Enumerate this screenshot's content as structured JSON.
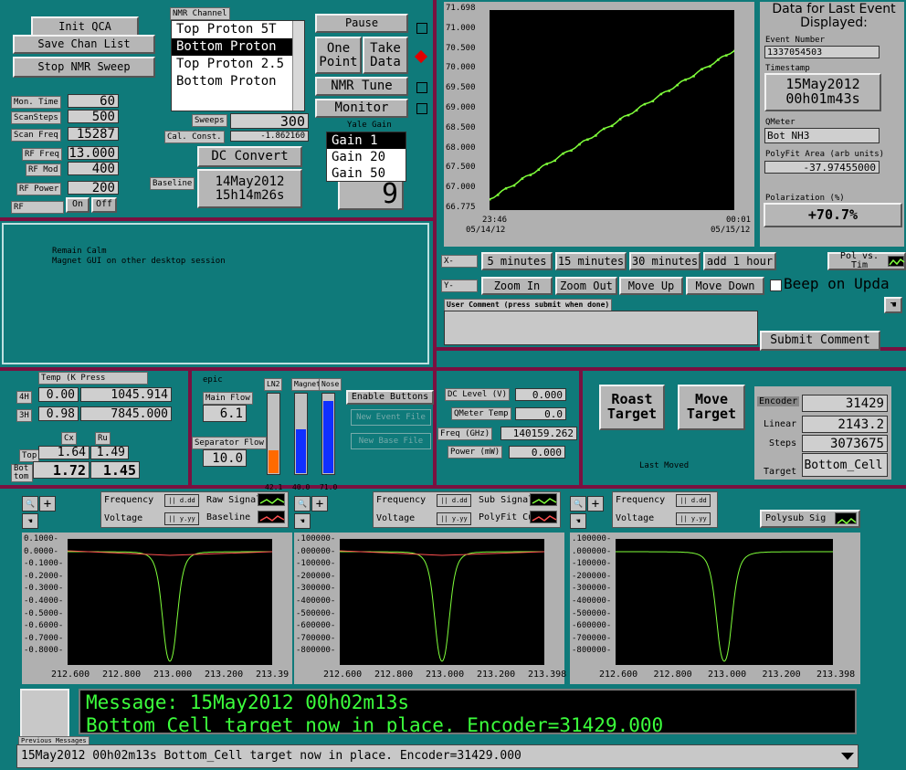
{
  "colors": {
    "bg": "#0f7a7a",
    "divider": "#7a1040",
    "trace_green": "#7fff3a",
    "trace_red": "#ff5050",
    "msg_green": "#3cff3c"
  },
  "left": {
    "init_qca": "Init QCA",
    "save_chan": "Save Chan List",
    "stop_nmr": "Stop NMR Sweep",
    "params": [
      {
        "label": "Mon. Time",
        "value": "60"
      },
      {
        "label": "ScanSteps",
        "value": "500"
      },
      {
        "label": "Scan Freq",
        "value": "15287"
      },
      {
        "label": "RF Freq",
        "value": "13.000"
      },
      {
        "label": "RF Mod",
        "value": "400"
      },
      {
        "label": "RF Power",
        "value": "200"
      }
    ],
    "rf_label": "RF",
    "on": "On",
    "off": "Off"
  },
  "nmr": {
    "channel_label": "NMR Channel",
    "channels": [
      "Top Proton 5T",
      "Bottom Proton",
      "Top Proton 2.5",
      "Bottom Proton"
    ],
    "sweeps_label": "Sweeps",
    "sweeps": "300",
    "calconst_label": "Cal. Const.",
    "calconst": "-1.862160",
    "dc_convert": "DC Convert",
    "baseline_label": "Baseline",
    "baseline_date": "14May2012",
    "baseline_time": "15h14m26s"
  },
  "controls": {
    "pause": "Pause",
    "one_point": "One Point",
    "take_data": "Take Data",
    "nmr_tune": "NMR Tune",
    "monitor": "Monitor",
    "yale_gain_label": "Yale Gain",
    "gains": [
      "Gain 1",
      "Gain 20",
      "Gain 50"
    ],
    "gain_value": "9"
  },
  "polplot": {
    "yticks": [
      "71.698",
      "71.000",
      "70.500",
      "70.000",
      "69.500",
      "69.000",
      "68.500",
      "68.000",
      "67.500",
      "67.000",
      "66.775"
    ],
    "x_left_time": "23:46",
    "x_left_date": "05/14/12",
    "x_right_time": "00:01",
    "x_right_date": "05/15/12"
  },
  "event": {
    "title": "Data for Last Event Displayed:",
    "event_number_label": "Event Number",
    "event_number": "1337054503",
    "timestamp_label": "Timestamp",
    "ts_date": "15May2012",
    "ts_time": "00h01m43s",
    "qmeter_label": "QMeter",
    "qmeter": "Bot NH3",
    "polyfit_label": "PolyFit Area (arb units)",
    "polyfit": "-37.97455000",
    "polarization_label": "Polarization (%)",
    "polarization": "+70.7%"
  },
  "xbar": {
    "label": "X-",
    "buttons": [
      "5 minutes",
      "15 minutes",
      "30 minutes",
      "add 1 hour"
    ],
    "polvs": "Pol vs. Tim"
  },
  "ybar": {
    "label": "Y-",
    "buttons": [
      "Zoom In",
      "Zoom Out",
      "Move Up",
      "Move Down"
    ],
    "beep": "Beep on Upda"
  },
  "comment": {
    "label": "User Comment (press submit when done)",
    "submit": "Submit Comment"
  },
  "textpanel": {
    "line1": "Remain Calm",
    "line2": "Magnet GUI on other desktop session"
  },
  "temps": {
    "header": "Temp (K Press",
    "rows": [
      {
        "label": "4H",
        "temp": "0.00",
        "press": "1045.914"
      },
      {
        "label": "3H",
        "temp": "0.98",
        "press": "7845.000"
      }
    ],
    "cx": "Cx",
    "ru": "Ru",
    "top_label": "Top",
    "top_cx": "1.64",
    "top_ru": "1.49",
    "bot_label": "Bot tom",
    "bot_cx": "1.72",
    "bot_ru": "1.45"
  },
  "flow": {
    "epic": "epic",
    "main_flow_label": "Main Flow",
    "main_flow": "6.1",
    "sep_flow_label": "Separator Flow",
    "sep_flow": "10.0",
    "therm_labels": [
      "LN2",
      "Magnet",
      "Nose"
    ],
    "therm_values": [
      "42.1",
      "40.0",
      "71.0"
    ],
    "therm_levels": [
      0.28,
      0.55,
      0.9
    ],
    "therm_colors": [
      "#ff6a00",
      "#1030ff",
      "#1030ff"
    ],
    "enable": "Enable Buttons",
    "new_event": "New Event File",
    "new_base": "New Base File"
  },
  "dc": {
    "dc_level_label": "DC Level (V)",
    "dc_level": "0.000",
    "qmeter_temp_label": "QMeter Temp",
    "qmeter_temp": "0.0",
    "freq_label": "Freq (GHz)",
    "freq": "140159.262",
    "power_label": "Power (mW)",
    "power": "0.000"
  },
  "target": {
    "roast": "Roast Target",
    "move": "Move Target",
    "last_moved": "Last Moved",
    "encoder_label": "Encoder",
    "encoder": "31429",
    "linear_label": "Linear",
    "linear": "2143.2",
    "steps_label": "Steps",
    "steps": "3073675",
    "target_label": "Target",
    "target": "Bottom_Cell"
  },
  "plots": [
    {
      "legend1": "Frequency",
      "legend2": "Voltage",
      "trace1": "Raw Signal",
      "trace2": "Baseline",
      "fmt": "%.4f",
      "yticks": [
        "0.1000-",
        "0.0000-",
        "-0.1000-",
        "-0.2000-",
        "-0.3000-",
        "-0.4000-",
        "-0.5000-",
        "-0.6000-",
        "-0.7000-",
        "-0.8000-"
      ],
      "xticks": [
        "212.600",
        "212.800",
        "213.000",
        "213.200",
        "213.39"
      ]
    },
    {
      "legend1": "Frequency",
      "legend2": "Voltage",
      "trace1": "Sub Signal",
      "trace2": "PolyFit Curve",
      "fmt": "%.4f",
      "yticks": [
        ".100000-",
        ".000000-",
        "-100000-",
        "-200000-",
        "-300000-",
        "-400000-",
        "-500000-",
        "-600000-",
        "-700000-",
        "-800000-"
      ],
      "xticks": [
        "212.600",
        "212.800",
        "213.000",
        "213.200",
        "213.398"
      ]
    },
    {
      "legend1": "Frequency",
      "legend2": "Voltage",
      "trace1": "Polysub Sig",
      "yticks": [
        ".100000-",
        ".000000-",
        "-100000-",
        "-200000-",
        "-300000-",
        "-400000-",
        "-500000-",
        "-600000-",
        "-700000-",
        "-800000-"
      ],
      "xticks": [
        "212.600",
        "212.800",
        "213.000",
        "213.200",
        "213.398"
      ]
    }
  ],
  "messages": {
    "line1": "Message: 15May2012 00h02m13s",
    "line2": "Bottom Cell target now in place.  Encoder=31429.000",
    "previous_label": "Previous Messages",
    "previous": "15May2012 00h02m13s Bottom_Cell target now in place.  Encoder=31429.000"
  }
}
